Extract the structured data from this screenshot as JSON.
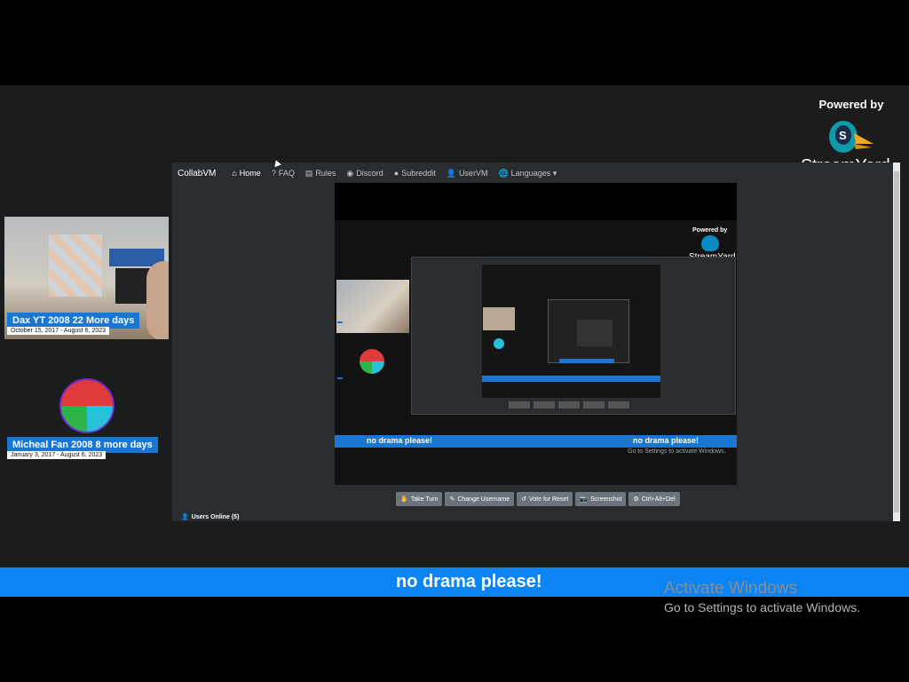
{
  "branding": {
    "powered_by": "Powered by",
    "streamyard": "StreamYard",
    "logo_icon": "streamyard-duck-icon",
    "logo_letter": "S"
  },
  "participants": [
    {
      "name": "Dax YT 2008 22 More days",
      "dates": "October 15, 2017 - August 6, 2023"
    },
    {
      "name": "Micheal Fan 2008 8 more days",
      "dates": "January 3, 2017 - August 6, 2023"
    }
  ],
  "collabvm": {
    "brand": "CollabVM",
    "nav": [
      {
        "label": "Home",
        "icon": "home-icon",
        "glyph": "⌂"
      },
      {
        "label": "FAQ",
        "icon": "question-icon",
        "glyph": "?"
      },
      {
        "label": "Rules",
        "icon": "rules-icon",
        "glyph": "▤"
      },
      {
        "label": "Discord",
        "icon": "discord-icon",
        "glyph": "◉"
      },
      {
        "label": "Subreddit",
        "icon": "reddit-icon",
        "glyph": "●"
      },
      {
        "label": "UserVM",
        "icon": "user-icon",
        "glyph": "👤"
      },
      {
        "label": "Languages ▾",
        "icon": "globe-icon",
        "glyph": "🌐"
      }
    ],
    "vm_banner_left": "no drama please!",
    "vm_banner_right": "no drama please!",
    "vm_activate": "Go to Settings to activate Windows.",
    "buttons": [
      {
        "label": "Take Turn",
        "icon": "hand-icon",
        "glyph": "✋"
      },
      {
        "label": "Change Username",
        "icon": "user-edit-icon",
        "glyph": "✎"
      },
      {
        "label": "Vote for Reset",
        "icon": "reset-icon",
        "glyph": "↺"
      },
      {
        "label": "Screenshot",
        "icon": "camera-icon",
        "glyph": "📷"
      },
      {
        "label": "Ctrl+Alt+Del",
        "icon": "gear-icon",
        "glyph": "⚙"
      }
    ],
    "users_online": "Users Online (5)",
    "nested_powered_by": "Powered by",
    "nested_streamyard": "StreamYard"
  },
  "banner": {
    "text": "no drama please!"
  },
  "activate_windows": {
    "title": "Activate Windows",
    "subtitle": "Go to Settings to activate Windows."
  }
}
